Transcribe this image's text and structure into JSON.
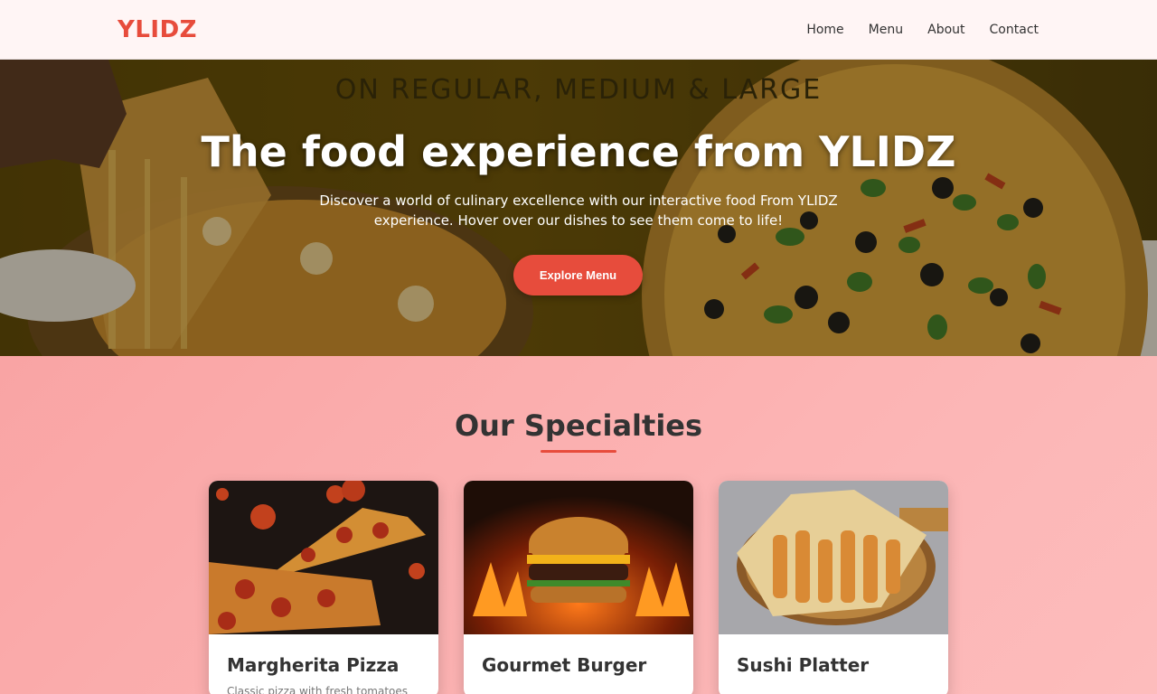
{
  "brand": {
    "logo": "YLIDZ",
    "accent": "#e74c3c"
  },
  "nav": {
    "items": [
      "Home",
      "Menu",
      "About",
      "Contact"
    ]
  },
  "hero": {
    "tagline": "ON REGULAR, MEDIUM & LARGE",
    "title": "The food experience from YLIDZ",
    "subtitle_line1": "Discover a world of culinary excellence with our interactive food From YLIDZ",
    "subtitle_line2": "experience. Hover over our dishes to see them come to life!",
    "cta": "Explore Menu"
  },
  "specialties": {
    "title": "Our Specialties",
    "items": [
      {
        "name": "Margherita Pizza",
        "desc": "Classic pizza with fresh tomatoes",
        "image": "pizza-image"
      },
      {
        "name": "Gourmet Burger",
        "desc": "",
        "image": "burger-image"
      },
      {
        "name": "Sushi Platter",
        "desc": "",
        "image": "wrap-image"
      }
    ]
  }
}
